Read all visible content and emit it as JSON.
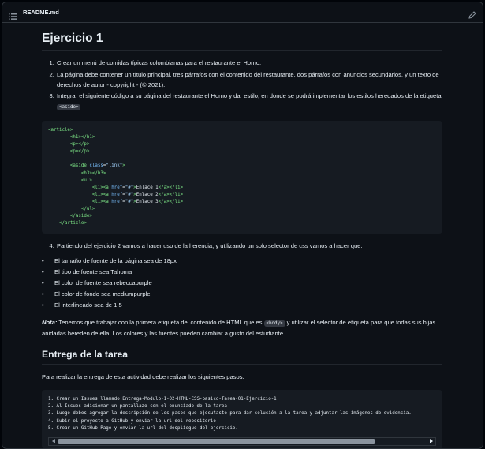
{
  "file_header": {
    "name": "README.md"
  },
  "h1": "Ejercicio 1",
  "steps": [
    {
      "text": "Crear un menú de comidas típicas colombianas para el restaurante el Horno."
    },
    {
      "text": "La página debe contener un título principal, tres párrafos con el contenido del restaurante, dos párrafos con anuncios secundarios, y un texto de derechos de autor - copyright - (© 2021)."
    },
    {
      "text": "Integrar el siguiente código a su página del restaurante el Horno y dar estilo, en donde se podrá implementar los estilos heredados de la etiqueta",
      "code": "<aside>"
    }
  ],
  "html_code": {
    "l1": "<article>",
    "l2": "<h1></h1>",
    "l3": "<p></p>",
    "l4": "<p></p>",
    "aside_open": "<aside",
    "class_attr": "class",
    "class_val": "\"link\"",
    "h3": "<h3></h3>",
    "ul_open": "<ul>",
    "li_open": "<li><a",
    "href_attr": "href",
    "href_val": "\"#\"",
    "link1": "Enlace 1",
    "link2": "Enlace 2",
    "link3": "Enlace 3",
    "li_close": "</a></li>",
    "ul_close": "</ul>",
    "aside_close": "</aside>",
    "article_close": "</article>"
  },
  "step4": "Partiendo del ejercicio 2 vamos a hacer uso de la herencia, y utilizando un solo selector de css vamos a hacer que:",
  "bullets": [
    "El tamaño de fuente de la página sea de 18px",
    "El tipo de fuente sea Tahoma",
    "El color de fuente sea rebeccapurple",
    "El color de fondo sea mediumpurple",
    "El interlineado sea de 1.5"
  ],
  "note": {
    "label": "Nota:",
    "text_before": " Tenemos que trabajar con la primera etiqueta del contenido de HTML que es ",
    "code": "<body>",
    "text_after": " y utilizar el selector de etiqueta para que todas sus hijas anidadas hereden de ella. Los colores y las fuentes pueden cambiar a gusto del estudiante."
  },
  "h2": "Entrega de la tarea",
  "intro": "Para realizar la entrega de esta actividad debe realizar los siguientes pasos:",
  "delivery_steps": [
    "1. Crear un Issues llamado Entrega-Modulo-1-02-HTML-CSS-basico-Tarea-01-Ejercicio-1",
    "2. Al Issues adicionar un pantallazo con el enunciado de la tarea",
    "3. Luego debes agregar la descripción de los pasos que ejecutaste para dar solución a la tarea y adjuntar las imágenes de evidencia.",
    "4. Subir el proyecto a GitHub y enviar la url del repositorio",
    "5. Crear un GitHub Page y enviar la url del despliegue del ejercicio."
  ],
  "colors": {
    "background": "#0d1117",
    "text": "#e6edf3",
    "code_bg": "#161b22",
    "tag_green": "#7ee787",
    "attr_blue": "#79c0ff",
    "string_blue": "#a5d6ff",
    "border": "#30363d"
  },
  "icons": {
    "header_left": "list-icon",
    "header_right": "pencil-icon"
  }
}
